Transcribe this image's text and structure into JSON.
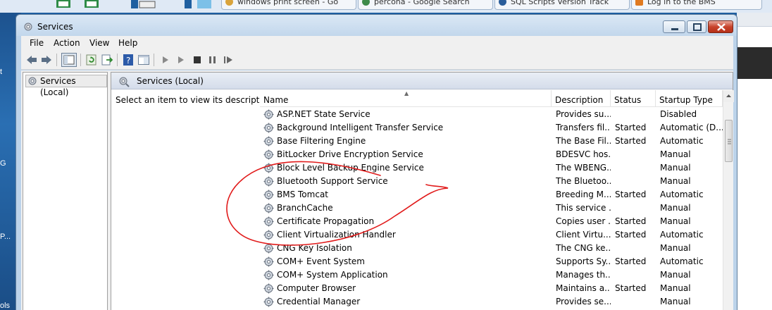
{
  "taskbar": {
    "tabs": [
      {
        "label": "windows print screen - Go",
        "favicon_color": "#d9a33b"
      },
      {
        "label": "percona - Google Search",
        "favicon_color": "#3e8b4a"
      },
      {
        "label": "SQL Scripts Version Track",
        "favicon_color": "#2a5d9a"
      },
      {
        "label": "Log in to the BMS",
        "favicon_color": "#e07a20"
      }
    ]
  },
  "desktop": {
    "labels": [
      "t",
      "G",
      "P...",
      "ols"
    ]
  },
  "window": {
    "title": "Services",
    "menu": [
      "File",
      "Action",
      "View",
      "Help"
    ]
  },
  "tree": {
    "item": "Services (Local)"
  },
  "pane": {
    "header": "Services (Local)",
    "description_prompt": "Select an item to view its description."
  },
  "table": {
    "columns": [
      "Name",
      "Description",
      "Status",
      "Startup Type"
    ],
    "rows": [
      {
        "name": "ASP.NET State Service",
        "description": "Provides su...",
        "status": "",
        "startup": "Disabled"
      },
      {
        "name": "Background Intelligent Transfer Service",
        "description": "Transfers fil...",
        "status": "Started",
        "startup": "Automatic (D..."
      },
      {
        "name": "Base Filtering Engine",
        "description": "The Base Fil...",
        "status": "Started",
        "startup": "Automatic"
      },
      {
        "name": "BitLocker Drive Encryption Service",
        "description": "BDESVC hos...",
        "status": "",
        "startup": "Manual"
      },
      {
        "name": "Block Level Backup Engine Service",
        "description": "The WBENG...",
        "status": "",
        "startup": "Manual"
      },
      {
        "name": "Bluetooth Support Service",
        "description": "The Bluetoo...",
        "status": "",
        "startup": "Manual"
      },
      {
        "name": "BMS Tomcat",
        "description": "Breeding M...",
        "status": "Started",
        "startup": "Automatic"
      },
      {
        "name": "BranchCache",
        "description": "This service ...",
        "status": "",
        "startup": "Manual"
      },
      {
        "name": "Certificate Propagation",
        "description": "Copies user ...",
        "status": "Started",
        "startup": "Manual"
      },
      {
        "name": "Client Virtualization Handler",
        "description": "Client Virtu...",
        "status": "Started",
        "startup": "Automatic"
      },
      {
        "name": "CNG Key Isolation",
        "description": "The CNG ke...",
        "status": "",
        "startup": "Manual"
      },
      {
        "name": "COM+ Event System",
        "description": "Supports Sy...",
        "status": "Started",
        "startup": "Automatic"
      },
      {
        "name": "COM+ System Application",
        "description": "Manages th...",
        "status": "",
        "startup": "Manual"
      },
      {
        "name": "Computer Browser",
        "description": "Maintains a...",
        "status": "Started",
        "startup": "Manual"
      },
      {
        "name": "Credential Manager",
        "description": "Provides se...",
        "status": "",
        "startup": "Manual"
      }
    ]
  },
  "colors": {
    "annotation": "#e11b1b",
    "window_frame": "#bcd3ea",
    "selection_header": "#d4dcea"
  }
}
